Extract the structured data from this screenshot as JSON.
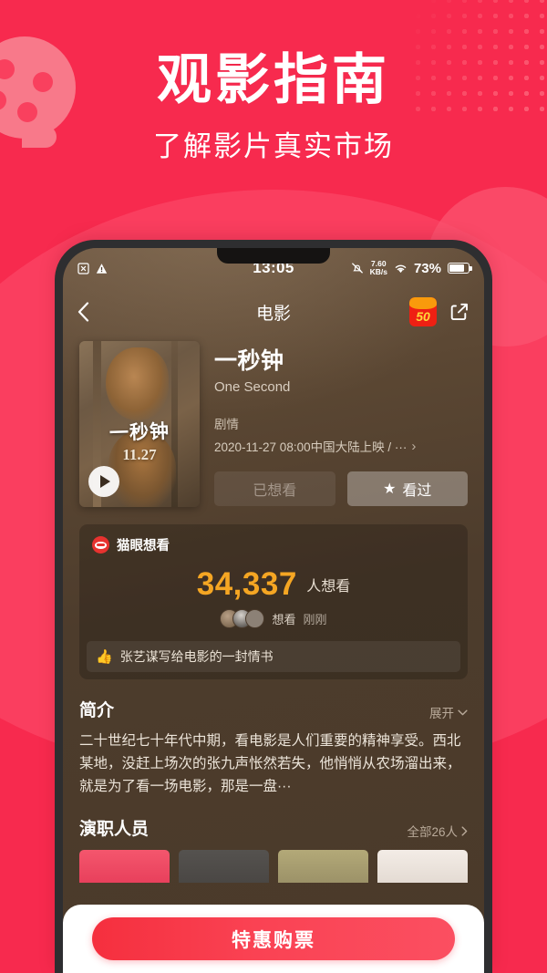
{
  "hero": {
    "title": "观影指南",
    "subtitle": "了解影片真实市场",
    "brand_red": "#f72a4e",
    "reel_icon": "film-reel-icon"
  },
  "phone": {
    "statusbar": {
      "sim_icon": "sim-card-icon",
      "warning_icon": "warning-triangle-icon",
      "time": "13:05",
      "mute_icon": "bell-muted-icon",
      "net_speed_value": "7.60",
      "net_speed_unit": "KB/s",
      "wifi_icon": "wifi-icon",
      "battery_percent": "73%",
      "battery_icon": "battery-icon"
    },
    "navbar": {
      "back_icon": "back-chevron-icon",
      "title": "电影",
      "promo_badge": "50",
      "promo_icon": "coupon-badge-icon",
      "share_icon": "share-icon"
    },
    "movie": {
      "poster": {
        "title_text": "一秒钟",
        "date_text": "11.27",
        "play_icon": "play-button-icon"
      },
      "title": "一秒钟",
      "english_title": "One Second",
      "genre": "剧情",
      "release": "2020-11-27 08:00中国大陆上映 / ···",
      "release_chevron": "›",
      "buttons": {
        "wish_label": "已想看",
        "seen_label": "看过",
        "seen_icon": "star-icon"
      }
    },
    "wish_card": {
      "logo_icon": "maoyan-cat-logo",
      "header_label": "猫眼想看",
      "count": "34,337",
      "count_unit": "人想看",
      "count_color": "#f5a623",
      "activity_action": "想看",
      "activity_time": "刚刚",
      "tag_icon": "thumbs-up-icon",
      "tag_text": "张艺谋写给电影的一封情书"
    },
    "synopsis": {
      "title": "简介",
      "action_label": "展开",
      "action_icon": "chevron-down-icon",
      "text": "二十世纪七十年代中期，看电影是人们重要的精神享受。西北某地，没赶上场次的张九声怅然若失，他悄悄从农场溜出来，就是为了看一场电影，那是一盘···"
    },
    "cast": {
      "title": "演职人员",
      "action_label": "全部26人",
      "action_icon": "chevron-right-icon"
    },
    "buybar": {
      "button_label": "特惠购票",
      "button_color": "#f52f3e"
    }
  }
}
